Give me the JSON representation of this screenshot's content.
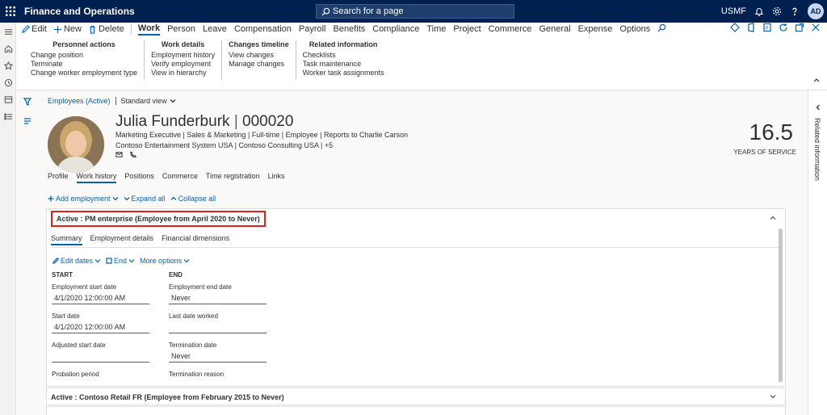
{
  "app": {
    "title": "Finance and Operations",
    "search_placeholder": "Search for a page",
    "company": "USMF",
    "user_initials": "AD"
  },
  "actionpane": {
    "actions": [
      "Edit",
      "New",
      "Delete"
    ],
    "tabs": [
      "Work",
      "Person",
      "Leave",
      "Compensation",
      "Payroll",
      "Benefits",
      "Compliance",
      "Time",
      "Project",
      "Commerce",
      "General",
      "Expense",
      "Options"
    ],
    "active_tab": "Work",
    "groups": [
      {
        "title": "Personnel actions",
        "items": [
          "Change position",
          "Terminate",
          "Change worker employment type"
        ]
      },
      {
        "title": "Work details",
        "items": [
          "Employment history",
          "Verify employment",
          "View in hierarchy"
        ]
      },
      {
        "title": "Changes timeline",
        "items": [
          "View changes",
          "Manage changes"
        ]
      },
      {
        "title": "Related information",
        "items": [
          "Checklists",
          "Task maintenance",
          "Worker task assignments"
        ]
      }
    ]
  },
  "breadcrumb": {
    "link": "Employees (Active)",
    "view": "Standard view"
  },
  "employee": {
    "name": "Julia Funderburk",
    "number": "000020",
    "line1": [
      "Marketing Executive",
      "Sales & Marketing",
      "Full-time",
      "Employee",
      "Reports to Charlie Carson"
    ],
    "line2": [
      "Contoso Entertainment System USA",
      "Contoso Consulting USA",
      "+5"
    ],
    "years": "16.5",
    "years_label": "YEARS OF SERVICE"
  },
  "profile_tabs": [
    "Profile",
    "Work history",
    "Positions",
    "Commerce",
    "Time registration",
    "Links"
  ],
  "profile_active": "Work history",
  "toolbar": {
    "add": "Add employment",
    "expand": "Expand all",
    "collapse": "Collapse all"
  },
  "card1": {
    "title": "Active : PM enterprise (Employee from April 2020 to Never)",
    "tabs": [
      "Summary",
      "Employment details",
      "Financial dimensions"
    ],
    "tools": {
      "edit_dates": "Edit dates",
      "end": "End",
      "more": "More options"
    },
    "start": {
      "heading": "START",
      "fields": [
        {
          "label": "Employment start date",
          "value": "4/1/2020 12:00:00 AM"
        },
        {
          "label": "Start date",
          "value": "4/1/2020 12:00:00 AM"
        },
        {
          "label": "Adjusted start date",
          "value": ""
        },
        {
          "label": "Probation period",
          "value": ""
        }
      ]
    },
    "end": {
      "heading": "END",
      "fields": [
        {
          "label": "Employment end date",
          "value": "Never"
        },
        {
          "label": "Last date worked",
          "value": ""
        },
        {
          "label": "Termination date",
          "value": "Never"
        },
        {
          "label": "Termination reason",
          "value": ""
        }
      ]
    }
  },
  "card2": {
    "title": "Active : Contoso Retail FR (Employee from February 2015 to Never)"
  },
  "related_info": "Related information"
}
